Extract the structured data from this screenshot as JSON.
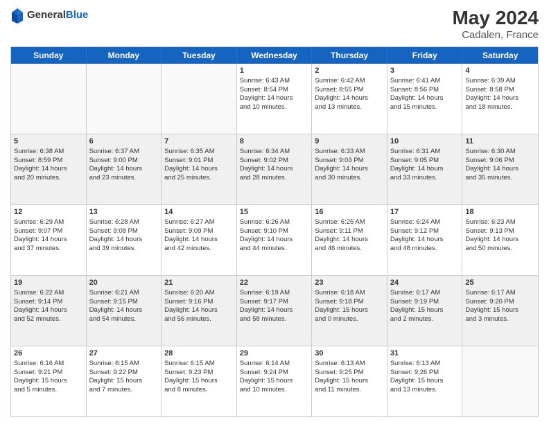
{
  "logo": {
    "general": "General",
    "blue": "Blue"
  },
  "title": {
    "month_year": "May 2024",
    "location": "Cadalen, France"
  },
  "day_headers": [
    "Sunday",
    "Monday",
    "Tuesday",
    "Wednesday",
    "Thursday",
    "Friday",
    "Saturday"
  ],
  "rows": [
    [
      {
        "day": "",
        "lines": [],
        "empty": true
      },
      {
        "day": "",
        "lines": [],
        "empty": true
      },
      {
        "day": "",
        "lines": [],
        "empty": true
      },
      {
        "day": "1",
        "lines": [
          "Sunrise: 6:43 AM",
          "Sunset: 8:54 PM",
          "Daylight: 14 hours",
          "and 10 minutes."
        ]
      },
      {
        "day": "2",
        "lines": [
          "Sunrise: 6:42 AM",
          "Sunset: 8:55 PM",
          "Daylight: 14 hours",
          "and 13 minutes."
        ]
      },
      {
        "day": "3",
        "lines": [
          "Sunrise: 6:41 AM",
          "Sunset: 8:56 PM",
          "Daylight: 14 hours",
          "and 15 minutes."
        ]
      },
      {
        "day": "4",
        "lines": [
          "Sunrise: 6:39 AM",
          "Sunset: 8:58 PM",
          "Daylight: 14 hours",
          "and 18 minutes."
        ]
      }
    ],
    [
      {
        "day": "5",
        "lines": [
          "Sunrise: 6:38 AM",
          "Sunset: 8:59 PM",
          "Daylight: 14 hours",
          "and 20 minutes."
        ]
      },
      {
        "day": "6",
        "lines": [
          "Sunrise: 6:37 AM",
          "Sunset: 9:00 PM",
          "Daylight: 14 hours",
          "and 23 minutes."
        ]
      },
      {
        "day": "7",
        "lines": [
          "Sunrise: 6:35 AM",
          "Sunset: 9:01 PM",
          "Daylight: 14 hours",
          "and 25 minutes."
        ]
      },
      {
        "day": "8",
        "lines": [
          "Sunrise: 6:34 AM",
          "Sunset: 9:02 PM",
          "Daylight: 14 hours",
          "and 28 minutes."
        ]
      },
      {
        "day": "9",
        "lines": [
          "Sunrise: 6:33 AM",
          "Sunset: 9:03 PM",
          "Daylight: 14 hours",
          "and 30 minutes."
        ]
      },
      {
        "day": "10",
        "lines": [
          "Sunrise: 6:31 AM",
          "Sunset: 9:05 PM",
          "Daylight: 14 hours",
          "and 33 minutes."
        ]
      },
      {
        "day": "11",
        "lines": [
          "Sunrise: 6:30 AM",
          "Sunset: 9:06 PM",
          "Daylight: 14 hours",
          "and 35 minutes."
        ]
      }
    ],
    [
      {
        "day": "12",
        "lines": [
          "Sunrise: 6:29 AM",
          "Sunset: 9:07 PM",
          "Daylight: 14 hours",
          "and 37 minutes."
        ]
      },
      {
        "day": "13",
        "lines": [
          "Sunrise: 6:28 AM",
          "Sunset: 9:08 PM",
          "Daylight: 14 hours",
          "and 39 minutes."
        ]
      },
      {
        "day": "14",
        "lines": [
          "Sunrise: 6:27 AM",
          "Sunset: 9:09 PM",
          "Daylight: 14 hours",
          "and 42 minutes."
        ]
      },
      {
        "day": "15",
        "lines": [
          "Sunrise: 6:26 AM",
          "Sunset: 9:10 PM",
          "Daylight: 14 hours",
          "and 44 minutes."
        ]
      },
      {
        "day": "16",
        "lines": [
          "Sunrise: 6:25 AM",
          "Sunset: 9:11 PM",
          "Daylight: 14 hours",
          "and 46 minutes."
        ]
      },
      {
        "day": "17",
        "lines": [
          "Sunrise: 6:24 AM",
          "Sunset: 9:12 PM",
          "Daylight: 14 hours",
          "and 48 minutes."
        ]
      },
      {
        "day": "18",
        "lines": [
          "Sunrise: 6:23 AM",
          "Sunset: 9:13 PM",
          "Daylight: 14 hours",
          "and 50 minutes."
        ]
      }
    ],
    [
      {
        "day": "19",
        "lines": [
          "Sunrise: 6:22 AM",
          "Sunset: 9:14 PM",
          "Daylight: 14 hours",
          "and 52 minutes."
        ]
      },
      {
        "day": "20",
        "lines": [
          "Sunrise: 6:21 AM",
          "Sunset: 9:15 PM",
          "Daylight: 14 hours",
          "and 54 minutes."
        ]
      },
      {
        "day": "21",
        "lines": [
          "Sunrise: 6:20 AM",
          "Sunset: 9:16 PM",
          "Daylight: 14 hours",
          "and 56 minutes."
        ]
      },
      {
        "day": "22",
        "lines": [
          "Sunrise: 6:19 AM",
          "Sunset: 9:17 PM",
          "Daylight: 14 hours",
          "and 58 minutes."
        ]
      },
      {
        "day": "23",
        "lines": [
          "Sunrise: 6:18 AM",
          "Sunset: 9:18 PM",
          "Daylight: 15 hours",
          "and 0 minutes."
        ]
      },
      {
        "day": "24",
        "lines": [
          "Sunrise: 6:17 AM",
          "Sunset: 9:19 PM",
          "Daylight: 15 hours",
          "and 2 minutes."
        ]
      },
      {
        "day": "25",
        "lines": [
          "Sunrise: 6:17 AM",
          "Sunset: 9:20 PM",
          "Daylight: 15 hours",
          "and 3 minutes."
        ]
      }
    ],
    [
      {
        "day": "26",
        "lines": [
          "Sunrise: 6:16 AM",
          "Sunset: 9:21 PM",
          "Daylight: 15 hours",
          "and 5 minutes."
        ]
      },
      {
        "day": "27",
        "lines": [
          "Sunrise: 6:15 AM",
          "Sunset: 9:22 PM",
          "Daylight: 15 hours",
          "and 7 minutes."
        ]
      },
      {
        "day": "28",
        "lines": [
          "Sunrise: 6:15 AM",
          "Sunset: 9:23 PM",
          "Daylight: 15 hours",
          "and 8 minutes."
        ]
      },
      {
        "day": "29",
        "lines": [
          "Sunrise: 6:14 AM",
          "Sunset: 9:24 PM",
          "Daylight: 15 hours",
          "and 10 minutes."
        ]
      },
      {
        "day": "30",
        "lines": [
          "Sunrise: 6:13 AM",
          "Sunset: 9:25 PM",
          "Daylight: 15 hours",
          "and 11 minutes."
        ]
      },
      {
        "day": "31",
        "lines": [
          "Sunrise: 6:13 AM",
          "Sunset: 9:26 PM",
          "Daylight: 15 hours",
          "and 13 minutes."
        ]
      },
      {
        "day": "",
        "lines": [],
        "empty": true
      }
    ]
  ]
}
